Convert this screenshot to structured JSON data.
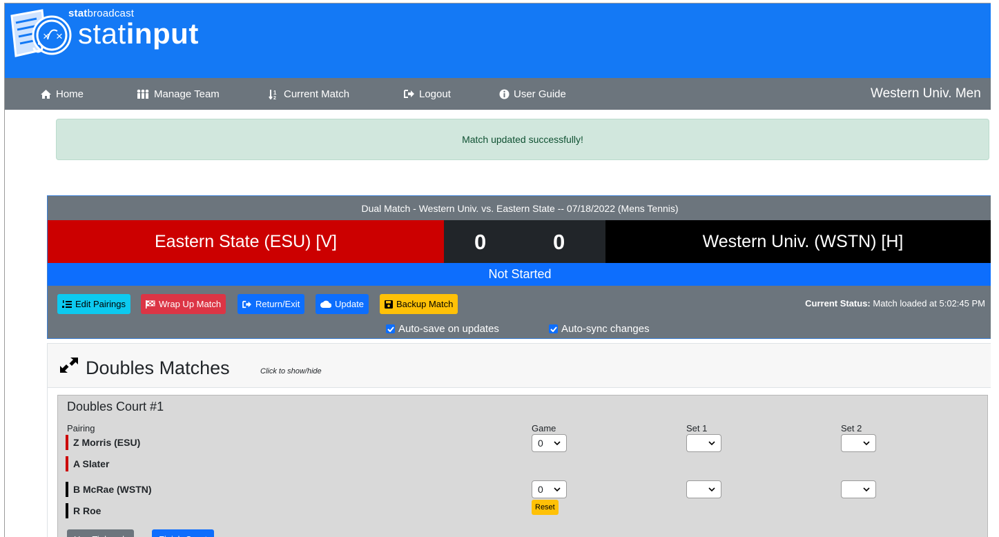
{
  "header": {
    "brand_small_bold": "stat",
    "brand_small_rest": "broadcast",
    "brand_big_light": "stat",
    "brand_big_bold": "input",
    "color": "#1479f5"
  },
  "nav": {
    "home": "Home",
    "manage_team": "Manage Team",
    "current_match": "Current Match",
    "logout": "Logout",
    "user_guide": "User Guide",
    "team_name": "Western Univ. Men"
  },
  "alert": {
    "message": "Match updated successfully!"
  },
  "match": {
    "heading": "Dual Match - Western Univ. vs. Eastern State -- 07/18/2022 (Mens Tennis)",
    "visitor": {
      "name": "Eastern State (ESU) [V]",
      "score": "0",
      "color": "#cc0000"
    },
    "home": {
      "name": "Western Univ. (WSTN) [H]",
      "score": "0",
      "color": "#000000"
    },
    "status": "Not Started",
    "buttons": {
      "edit_pairings": "Edit Pairings",
      "wrap_up": "Wrap Up Match",
      "return_exit": "Return/Exit",
      "update": "Update",
      "backup": "Backup Match"
    },
    "current_status_label": "Current Status:",
    "current_status_value": "Match loaded at 5:02:45 PM",
    "auto_save": {
      "label": "Auto-save on updates",
      "checked": true
    },
    "auto_sync": {
      "label": "Auto-sync changes",
      "checked": true
    }
  },
  "doubles": {
    "title": "Doubles Matches",
    "hint": "Click to show/hide",
    "court": {
      "title": "Doubles Court #1",
      "pairing_label": "Pairing",
      "game_label": "Game",
      "set1_label": "Set 1",
      "set2_label": "Set 2",
      "visitor_players": [
        "Z Morris (ESU)",
        "A Slater"
      ],
      "home_players": [
        "B McRae (WSTN)",
        "R Roe"
      ],
      "visitor_game": "0",
      "home_game": "0",
      "visitor_set1": "",
      "visitor_set2": "",
      "home_set1": "",
      "home_set2": "",
      "reset_label": "Reset",
      "use_tiebreak_label": "Use Tiebreak",
      "finish_court_label": "Finish Court"
    }
  }
}
